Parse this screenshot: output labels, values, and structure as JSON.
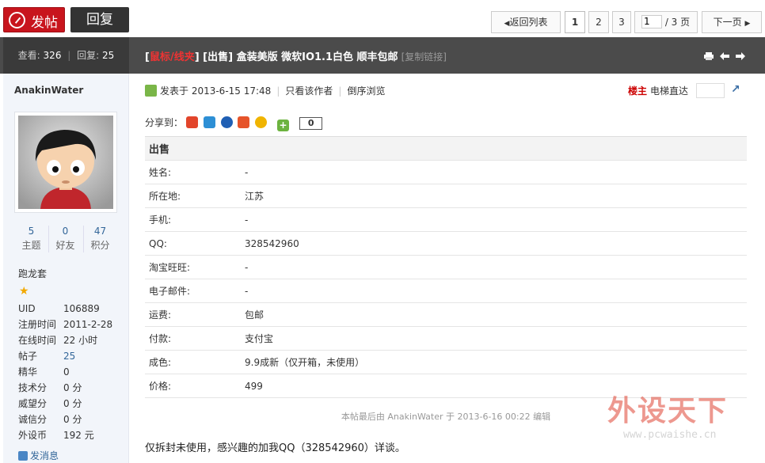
{
  "toolbar": {
    "post_label": "发帖",
    "reply_label": "回复"
  },
  "pager": {
    "back_label": "返回列表",
    "pages": [
      "1",
      "2",
      "3"
    ],
    "current_value": "1",
    "total_label": "/ 3 页",
    "next_label": "下一页"
  },
  "thread": {
    "views_label": "查看:",
    "views": "326",
    "replies_label": "回复:",
    "replies": "25",
    "category": "鼠标/线夹",
    "title": "[出售] 盒装美版 微软IO1.1白色 顺丰包邮",
    "copy_link_label": "[复制链接]"
  },
  "author": {
    "name": "AnakinWater",
    "stats": [
      {
        "value": "5",
        "label": "主题"
      },
      {
        "value": "0",
        "label": "好友"
      },
      {
        "value": "47",
        "label": "积分"
      }
    ],
    "group": "跑龙套",
    "info": [
      {
        "k": "UID",
        "v": "106889"
      },
      {
        "k": "注册时间",
        "v": "2011-2-28"
      },
      {
        "k": "在线时间",
        "v": "22 小时"
      },
      {
        "k": "帖子",
        "v": "25"
      },
      {
        "k": "精华",
        "v": "0"
      },
      {
        "k": "技术分",
        "v": "0 分"
      },
      {
        "k": "威望分",
        "v": "0 分"
      },
      {
        "k": "诚信分",
        "v": "0 分"
      },
      {
        "k": "外设币",
        "v": "192 元"
      }
    ],
    "message_label": "发消息"
  },
  "post": {
    "posted_at": "发表于 2013-6-15 17:48",
    "only_author_label": "只看该作者",
    "reverse_label": "倒序浏览",
    "floor_label": "楼主",
    "lift_label": "电梯直达",
    "share_label": "分享到：",
    "share_count": "0",
    "table_title": "出售",
    "fields": [
      {
        "k": "姓名:",
        "v": "-"
      },
      {
        "k": "所在地:",
        "v": "江苏"
      },
      {
        "k": "手机:",
        "v": "-"
      },
      {
        "k": "QQ:",
        "v": "328542960"
      },
      {
        "k": "淘宝旺旺:",
        "v": "-"
      },
      {
        "k": "电子邮件:",
        "v": "-"
      },
      {
        "k": "运费:",
        "v": "包邮"
      },
      {
        "k": "付款:",
        "v": "支付宝"
      },
      {
        "k": "成色:",
        "v": "9.9成新（仅开箱，未使用）"
      },
      {
        "k": "价格:",
        "v": "499"
      }
    ],
    "edit_note": "本帖最后由 AnakinWater 于 2013-6-16 00:22 编辑",
    "body": "仅拆封未使用，感兴趣的加我QQ（328542960）详谈。"
  },
  "watermark": {
    "text": "外设天下",
    "url": "www.pcwaishe.cn"
  }
}
